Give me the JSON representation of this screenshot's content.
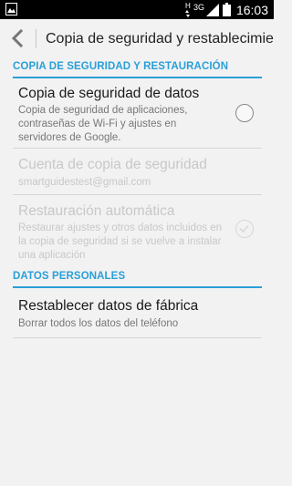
{
  "status_bar": {
    "time": "16:03",
    "network_type": "3G",
    "roaming_indicator": "H",
    "icons": [
      "image-notification-icon",
      "signal-icon",
      "battery-icon"
    ]
  },
  "action_bar": {
    "title": "Copia de seguridad y restablecimiento",
    "back_icon": "chevron-left-icon"
  },
  "sections": [
    {
      "header": "COPIA DE SEGURIDAD Y RESTAURACIÓN",
      "items": [
        {
          "title": "Copia de seguridad de datos",
          "summary": "Copia de seguridad de aplicaciones, contraseñas de Wi-Fi y ajustes en servidores de Google.",
          "enabled": true,
          "checked": false
        },
        {
          "title": "Cuenta de copia de seguridad",
          "summary": "smartguidestest@gmail.com",
          "enabled": false
        },
        {
          "title": "Restauración automática",
          "summary": "Restaurar ajustes y otros datos incluidos en la copia de seguridad si se vuelve a instalar una aplicación",
          "enabled": false,
          "checked": true
        }
      ]
    },
    {
      "header": "DATOS PERSONALES",
      "items": [
        {
          "title": "Restablecer datos de fábrica",
          "summary": "Borrar todos los datos del teléfono",
          "enabled": true
        }
      ]
    }
  ],
  "colors": {
    "accent": "#2a9fd8",
    "background": "#f2f2f2",
    "status_bar": "#000000"
  }
}
